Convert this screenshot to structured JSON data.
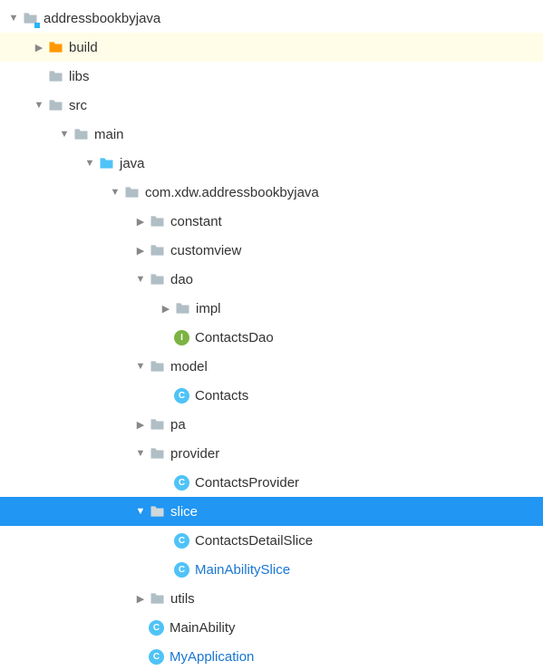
{
  "tree": [
    {
      "id": "addressbookbyjava",
      "label": "addressbookbyjava",
      "indent": 0,
      "arrow": "down",
      "icon": "folder-module",
      "folderColor": "#b0bec5",
      "highlighted": false
    },
    {
      "id": "build",
      "label": "build",
      "indent": 1,
      "arrow": "right",
      "icon": "folder",
      "folderColor": "#ff9800",
      "highlighted": true
    },
    {
      "id": "libs",
      "label": "libs",
      "indent": 1,
      "arrow": "none",
      "icon": "folder",
      "folderColor": "#b0bec5"
    },
    {
      "id": "src",
      "label": "src",
      "indent": 1,
      "arrow": "down",
      "icon": "folder",
      "folderColor": "#b0bec5"
    },
    {
      "id": "main",
      "label": "main",
      "indent": 2,
      "arrow": "down",
      "icon": "folder",
      "folderColor": "#b0bec5"
    },
    {
      "id": "java",
      "label": "java",
      "indent": 3,
      "arrow": "down",
      "icon": "folder",
      "folderColor": "#4fc3f7"
    },
    {
      "id": "pkg",
      "label": "com.xdw.addressbookbyjava",
      "indent": 4,
      "arrow": "down",
      "icon": "folder",
      "folderColor": "#b0bec5"
    },
    {
      "id": "constant",
      "label": "constant",
      "indent": 5,
      "arrow": "right",
      "icon": "folder",
      "folderColor": "#b0bec5"
    },
    {
      "id": "customview",
      "label": "customview",
      "indent": 5,
      "arrow": "right",
      "icon": "folder",
      "folderColor": "#b0bec5"
    },
    {
      "id": "dao",
      "label": "dao",
      "indent": 5,
      "arrow": "down",
      "icon": "folder",
      "folderColor": "#b0bec5"
    },
    {
      "id": "impl",
      "label": "impl",
      "indent": 6,
      "arrow": "right",
      "icon": "folder",
      "folderColor": "#b0bec5"
    },
    {
      "id": "contactsdao",
      "label": "ContactsDao",
      "indent": 6,
      "arrow": "none",
      "icon": "interface"
    },
    {
      "id": "model",
      "label": "model",
      "indent": 5,
      "arrow": "down",
      "icon": "folder",
      "folderColor": "#b0bec5"
    },
    {
      "id": "contacts",
      "label": "Contacts",
      "indent": 6,
      "arrow": "none",
      "icon": "class"
    },
    {
      "id": "pa",
      "label": "pa",
      "indent": 5,
      "arrow": "right",
      "icon": "folder",
      "folderColor": "#b0bec5"
    },
    {
      "id": "provider",
      "label": "provider",
      "indent": 5,
      "arrow": "down",
      "icon": "folder",
      "folderColor": "#b0bec5"
    },
    {
      "id": "contactsprovider",
      "label": "ContactsProvider",
      "indent": 6,
      "arrow": "none",
      "icon": "class"
    },
    {
      "id": "slice",
      "label": "slice",
      "indent": 5,
      "arrow": "down",
      "icon": "folder",
      "folderColor": "#cfd8dc",
      "selected": true
    },
    {
      "id": "contactsdetailslice",
      "label": "ContactsDetailSlice",
      "indent": 6,
      "arrow": "none",
      "icon": "class"
    },
    {
      "id": "mainabilityslice",
      "label": "MainAbilitySlice",
      "indent": 6,
      "arrow": "none",
      "icon": "class",
      "link": true
    },
    {
      "id": "utils",
      "label": "utils",
      "indent": 5,
      "arrow": "right",
      "icon": "folder",
      "folderColor": "#b0bec5"
    },
    {
      "id": "mainability",
      "label": "MainAbility",
      "indent": 5,
      "arrow": "none",
      "icon": "class"
    },
    {
      "id": "myapplication",
      "label": "MyApplication",
      "indent": 5,
      "arrow": "none",
      "icon": "class",
      "link": true
    }
  ],
  "iconLetters": {
    "class": "C",
    "interface": "I"
  }
}
